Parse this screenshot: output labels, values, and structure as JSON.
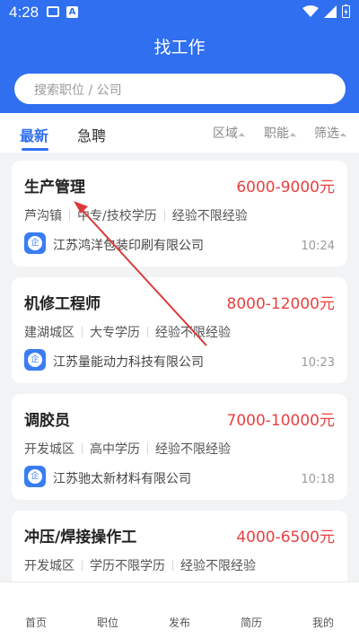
{
  "status": {
    "time": "4:28"
  },
  "header": {
    "title": "找工作",
    "search_placeholder": "搜索职位 / 公司"
  },
  "tabs": [
    {
      "label": "最新",
      "active": true
    },
    {
      "label": "急聘",
      "active": false
    }
  ],
  "filters": [
    "区域",
    "职能",
    "筛选"
  ],
  "jobs": [
    {
      "title": "生产管理",
      "salary": "6000-9000元",
      "tags": [
        "芦沟镇",
        "中专/技校学历",
        "经验不限经验"
      ],
      "company": "江苏鸿洋包装印刷有限公司",
      "time": "10:24"
    },
    {
      "title": "机修工程师",
      "salary": "8000-12000元",
      "tags": [
        "建湖城区",
        "大专学历",
        "经验不限经验"
      ],
      "company": "江苏量能动力科技有限公司",
      "time": "10:23"
    },
    {
      "title": "调胶员",
      "salary": "7000-10000元",
      "tags": [
        "开发城区",
        "高中学历",
        "经验不限经验"
      ],
      "company": "江苏驰太新材料有限公司",
      "time": "10:18"
    },
    {
      "title": "冲压/焊接操作工",
      "salary": "4000-6500元",
      "tags": [
        "开发城区",
        "学历不限学历",
        "经验不限经验"
      ],
      "company": "",
      "time": ""
    }
  ],
  "nav": [
    "首页",
    "职位",
    "发布",
    "简历",
    "我的"
  ],
  "colors": {
    "primary": "#2f6ff0",
    "salary": "#e94040",
    "annotation_arrow": "#d93a3a"
  }
}
